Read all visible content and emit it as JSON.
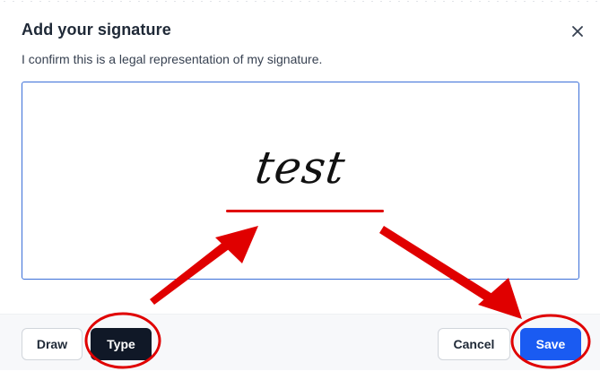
{
  "dialog": {
    "title": "Add your signature",
    "subtitle": "I confirm this is a legal representation of my signature.",
    "close_icon": "close-icon"
  },
  "signature": {
    "text": "test"
  },
  "footer": {
    "draw_label": "Draw",
    "type_label": "Type",
    "cancel_label": "Cancel",
    "save_label": "Save"
  },
  "colors": {
    "primary": "#1a5bf2",
    "dark": "#101827",
    "annotation": "#e00000",
    "focus_border": "#3b6fd8"
  }
}
